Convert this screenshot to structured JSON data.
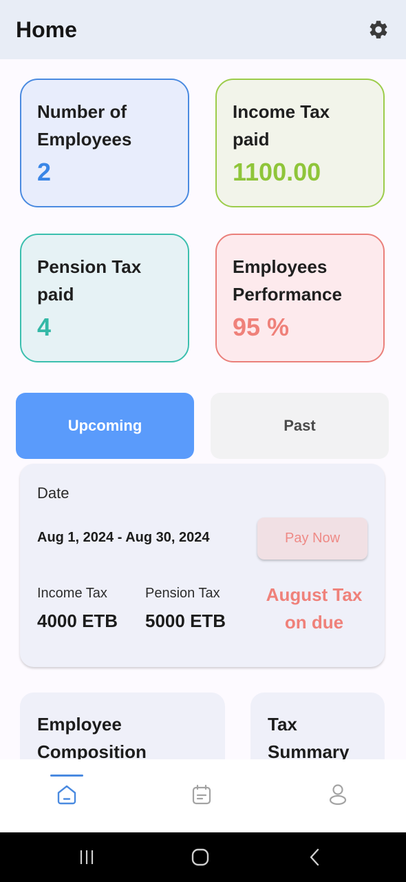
{
  "appbar": {
    "title": "Home",
    "settings_icon": "gear-icon"
  },
  "stats": [
    {
      "label": "Number of Employees",
      "value": "2",
      "color": "#3a86e6"
    },
    {
      "label": "Income Tax paid",
      "value": "1100.00",
      "color": "#8fc53a"
    },
    {
      "label": "Pension Tax paid",
      "value": "4",
      "color": "#34b8a6"
    },
    {
      "label": "Employees Performance",
      "value": "95 %",
      "color": "#ef817a"
    }
  ],
  "tabs": [
    {
      "label": "Upcoming",
      "active": true
    },
    {
      "label": "Past",
      "active": false
    }
  ],
  "due": {
    "date_label": "Date",
    "date_range": "Aug 1, 2024 - Aug 30, 2024",
    "pay_label": "Pay Now",
    "income_tax_label": "Income Tax",
    "income_tax_amount": "4000 ETB",
    "pension_tax_label": "Pension Tax",
    "pension_tax_amount": "5000 ETB",
    "status": "August Tax on due"
  },
  "sections": [
    {
      "title": "Employee Composition"
    },
    {
      "title": "Tax Summary"
    }
  ],
  "bottom_nav": [
    {
      "icon": "home-icon",
      "active": true
    },
    {
      "icon": "calendar-icon",
      "active": false
    },
    {
      "icon": "profile-icon",
      "active": false
    }
  ],
  "system_nav": [
    "recent-apps-icon",
    "home-circle-icon",
    "back-icon"
  ],
  "colors": {
    "accent": "#5a9bfb",
    "appbar": "#e8edf6"
  }
}
